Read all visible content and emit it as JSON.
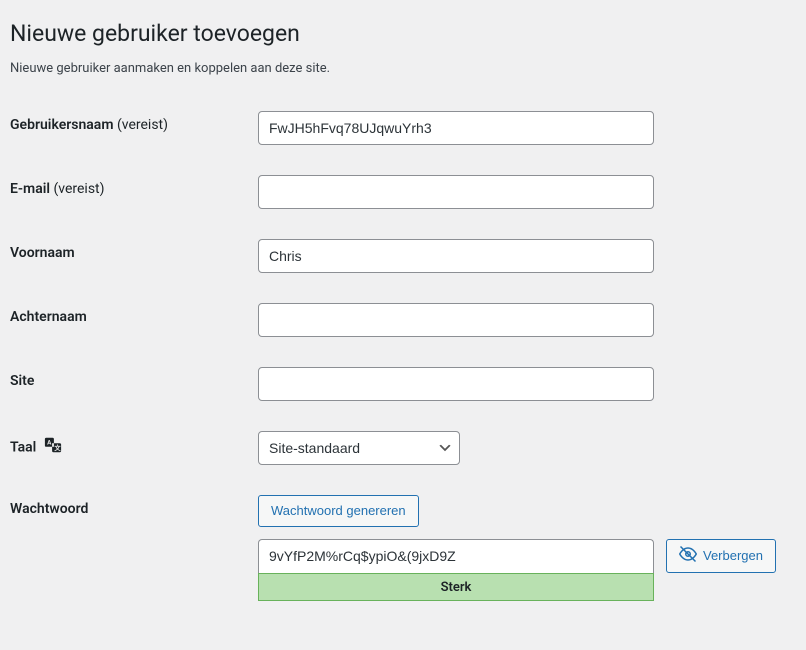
{
  "page": {
    "title": "Nieuwe gebruiker toevoegen",
    "subtitle": "Nieuwe gebruiker aanmaken en koppelen aan deze site."
  },
  "form": {
    "username": {
      "label": "Gebruikersnaam",
      "required": "(vereist)",
      "value": "FwJH5hFvq78UJqwuYrh3"
    },
    "email": {
      "label": "E-mail",
      "required": "(vereist)",
      "value": ""
    },
    "firstname": {
      "label": "Voornaam",
      "value": "Chris"
    },
    "lastname": {
      "label": "Achternaam",
      "value": ""
    },
    "site": {
      "label": "Site",
      "value": ""
    },
    "language": {
      "label": "Taal",
      "value": "Site-standaard"
    },
    "password": {
      "label": "Wachtwoord",
      "generate_button": "Wachtwoord genereren",
      "value": "9vYfP2M%rCq$ypiO&(9jxD9Z",
      "strength": "Sterk",
      "hide_button": "Verbergen"
    }
  }
}
